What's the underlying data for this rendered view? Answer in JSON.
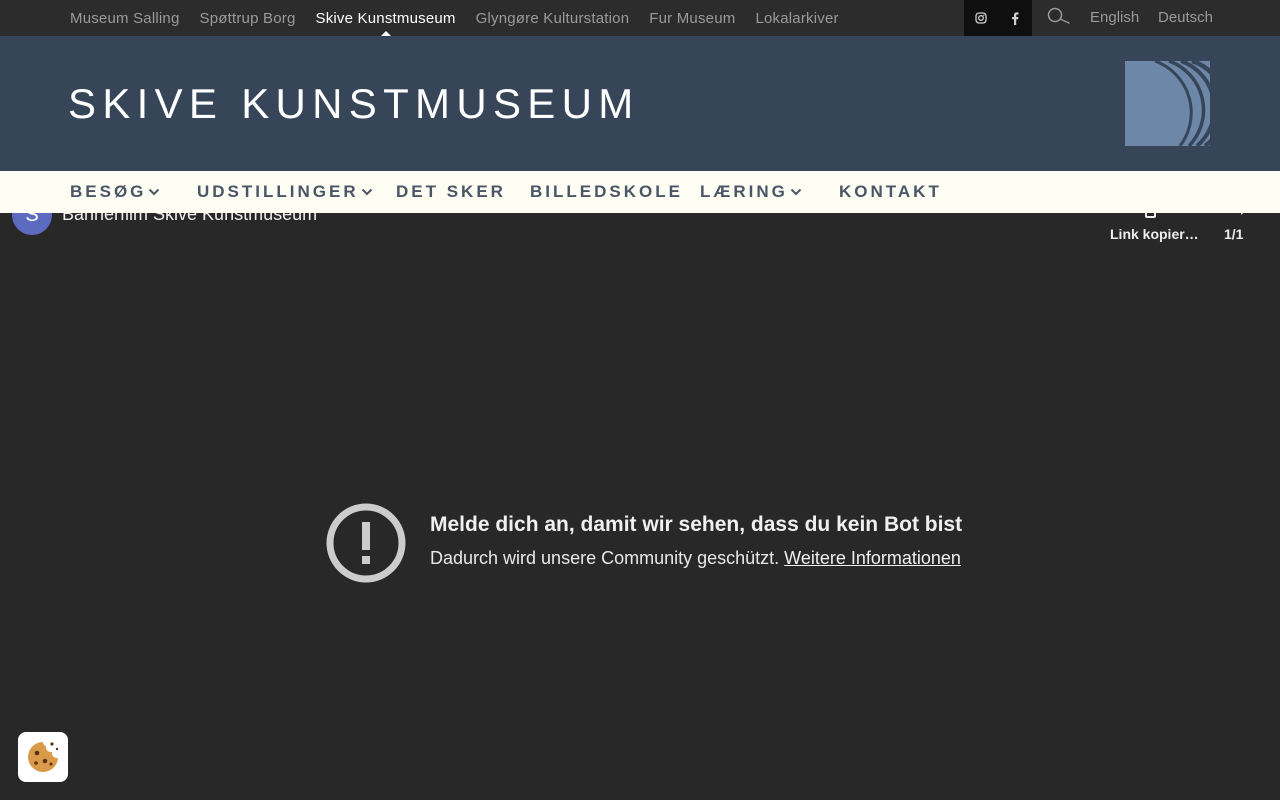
{
  "topbar": {
    "sites": [
      {
        "label": "Museum Salling",
        "active": false
      },
      {
        "label": "Spøttrup Borg",
        "active": false
      },
      {
        "label": "Skive Kunstmuseum",
        "active": true
      },
      {
        "label": "Glyngøre Kulturstation",
        "active": false
      },
      {
        "label": "Fur Museum",
        "active": false
      },
      {
        "label": "Lokalarkiver",
        "active": false
      }
    ],
    "languages": [
      "English",
      "Deutsch"
    ]
  },
  "header": {
    "title": "SKIVE KUNSTMUSEUM",
    "logo_color": "#6d87a8"
  },
  "nav": {
    "items": [
      {
        "label": "BESØG",
        "has_dropdown": true
      },
      {
        "label": "UDSTILLINGER",
        "has_dropdown": true
      },
      {
        "label": "DET SKER",
        "has_dropdown": false
      },
      {
        "label": "BILLEDSKOLE",
        "has_dropdown": false
      },
      {
        "label": "LÆRING",
        "has_dropdown": true
      },
      {
        "label": "KONTAKT",
        "has_dropdown": false
      }
    ]
  },
  "video": {
    "avatar_letter": "S",
    "title": "Bannerfilm Skive Kunstmuseum",
    "copy_label": "Link kopier…",
    "counter": "1/1"
  },
  "notice": {
    "title": "Melde dich an, damit wir sehen, dass du kein Bot bist",
    "body": "Dadurch wird unsere Community geschützt.",
    "link": "Weitere Informationen"
  },
  "colors": {
    "header_bg": "#374558",
    "nav_bg": "#fdfdf3",
    "nav_text": "#4a5566",
    "avatar_bg": "#5c6bc0"
  },
  "icons": {
    "instagram": "instagram-icon",
    "facebook": "facebook-icon",
    "search": "search-icon",
    "cookie": "cookie-icon",
    "warning": "exclamation-circle-icon"
  }
}
